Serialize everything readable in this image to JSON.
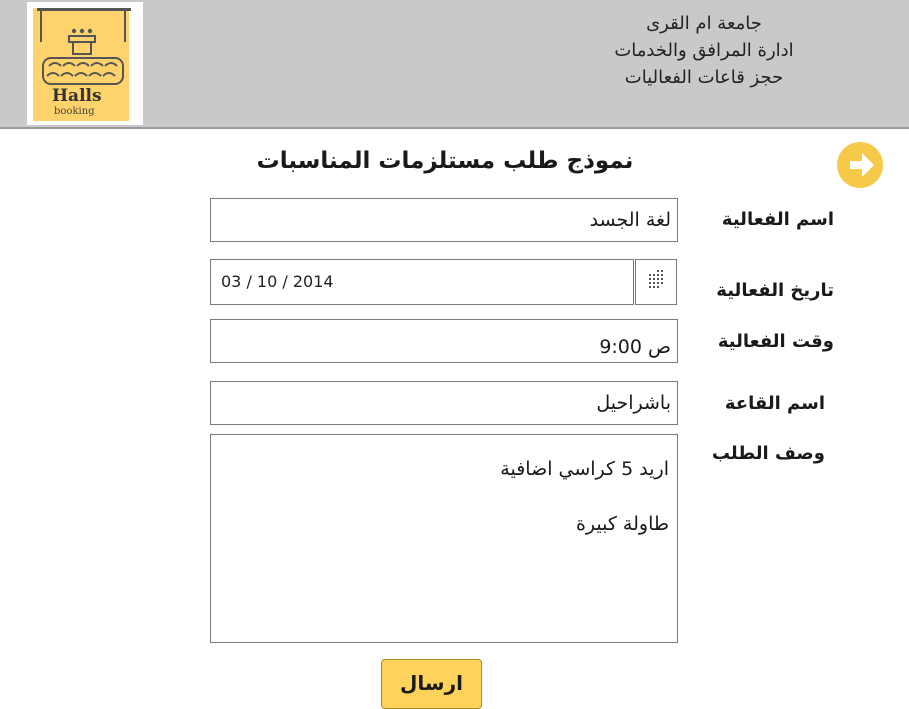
{
  "header": {
    "lines": [
      "جامعة ام القرى",
      "ادارة المرافق والخدمات",
      "حجز قاعات الفعاليات"
    ],
    "logo": {
      "title": "Halls",
      "subtitle": "booking",
      "accent_color": "#ffd36b"
    }
  },
  "form": {
    "title": "نموذج طلب مستلزمات المناسبات",
    "event_name": {
      "label": "اسم الفعالية",
      "value": "لغة الجسد"
    },
    "event_date": {
      "label": "تاريخ الفعالية",
      "value": "03 / 10 / 2014"
    },
    "event_time": {
      "label": "وقت الفعالية",
      "value": "ص 9:00"
    },
    "hall_name": {
      "label": "اسم القاعة",
      "value": "باشراحيل"
    },
    "description": {
      "label": "وصف الطلب",
      "lines": [
        "اريد 5 كراسي اضافية",
        "طاولة كبيرة"
      ]
    },
    "submit_label": "ارسال"
  },
  "icons": {
    "nav": "arrow-right-circle-icon",
    "calendar": "calendar-grid-icon"
  },
  "colors": {
    "header_bg": "#c9c9c9",
    "accent": "#ffd25c",
    "arrow": "#f7c948"
  }
}
